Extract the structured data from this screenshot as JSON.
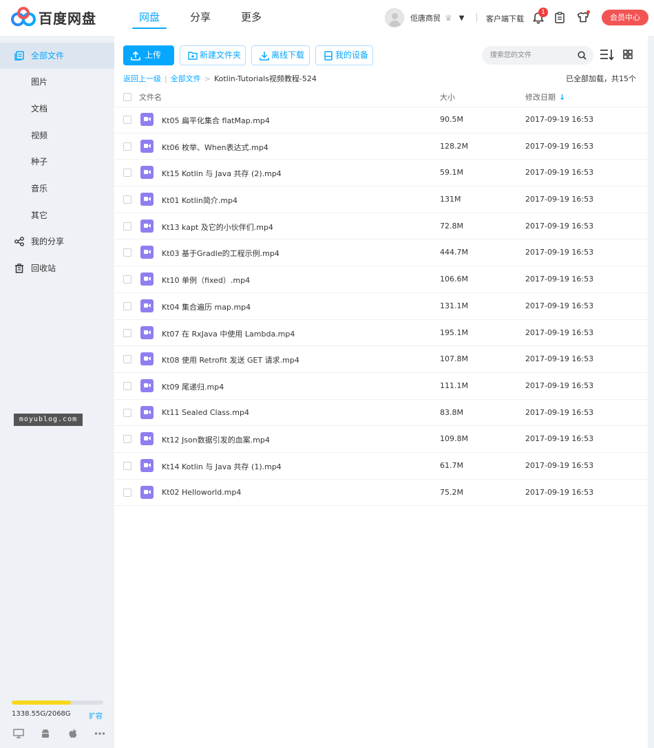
{
  "app": {
    "logo_text": "百度网盘",
    "nav": [
      "网盘",
      "分享",
      "更多"
    ],
    "username": "佢唐商贸",
    "client_download": "客户端下载",
    "notification_count": "1",
    "vip_label": "会员中心"
  },
  "colors": {
    "accent": "#06a7ff",
    "vip": "#f25454",
    "quota": "#f8d71c",
    "video_icon": "#8d7ff0"
  },
  "sidebar": {
    "items": [
      {
        "label": "全部文件",
        "icon": "files-icon",
        "active": true
      },
      {
        "label": "图片"
      },
      {
        "label": "文档"
      },
      {
        "label": "视频"
      },
      {
        "label": "种子"
      },
      {
        "label": "音乐"
      },
      {
        "label": "其它"
      },
      {
        "label": "我的分享",
        "icon": "share-icon"
      },
      {
        "label": "回收站",
        "icon": "trash-icon"
      }
    ],
    "watermark": "moyublog.com",
    "quota_text": "1338.55G/2068G",
    "quota_used_fraction": 0.647,
    "expand_label": "扩容",
    "devices": [
      "desktop-icon",
      "android-icon",
      "apple-icon",
      "more-icon"
    ]
  },
  "toolbar": {
    "upload": "上传",
    "new_folder": "新建文件夹",
    "offline_download": "离线下载",
    "my_devices": "我的设备",
    "search_placeholder": "搜索您的文件"
  },
  "breadcrumb": {
    "back": "返回上一级",
    "sep1": "|",
    "root": "全部文件",
    "sep2": ">",
    "current": "Kotlin-Tutorials视频教程-524"
  },
  "status": "已全部加载，共15个",
  "columns": {
    "name": "文件名",
    "size": "大小",
    "date": "修改日期",
    "date_sort": "↓"
  },
  "files": [
    {
      "name": "Kt05 扁平化集合 flatMap.mp4",
      "size": "90.5M",
      "date": "2017-09-19 16:53"
    },
    {
      "name": "Kt06 枚举、When表达式.mp4",
      "size": "128.2M",
      "date": "2017-09-19 16:53"
    },
    {
      "name": "Kt15 Kotlin 与 Java 共存 (2).mp4",
      "size": "59.1M",
      "date": "2017-09-19 16:53"
    },
    {
      "name": "Kt01 Kotlin简介.mp4",
      "size": "131M",
      "date": "2017-09-19 16:53"
    },
    {
      "name": "Kt13 kapt 及它的小伙伴们.mp4",
      "size": "72.8M",
      "date": "2017-09-19 16:53"
    },
    {
      "name": "Kt03 基于Gradle的工程示例.mp4",
      "size": "444.7M",
      "date": "2017-09-19 16:53"
    },
    {
      "name": "Kt10 单例（fixed）.mp4",
      "size": "106.6M",
      "date": "2017-09-19 16:53"
    },
    {
      "name": "Kt04 集合遍历 map.mp4",
      "size": "131.1M",
      "date": "2017-09-19 16:53"
    },
    {
      "name": "Kt07 在 RxJava 中使用 Lambda.mp4",
      "size": "195.1M",
      "date": "2017-09-19 16:53"
    },
    {
      "name": "Kt08 使用 Retrofit 发送 GET 请求.mp4",
      "size": "107.8M",
      "date": "2017-09-19 16:53"
    },
    {
      "name": "Kt09 尾递归.mp4",
      "size": "111.1M",
      "date": "2017-09-19 16:53"
    },
    {
      "name": "Kt11 Sealed Class.mp4",
      "size": "83.8M",
      "date": "2017-09-19 16:53"
    },
    {
      "name": "Kt12 Json数据引发的血案.mp4",
      "size": "109.8M",
      "date": "2017-09-19 16:53"
    },
    {
      "name": "Kt14 Kotlin 与 Java 共存 (1).mp4",
      "size": "61.7M",
      "date": "2017-09-19 16:53"
    },
    {
      "name": "Kt02 Helloworld.mp4",
      "size": "75.2M",
      "date": "2017-09-19 16:53"
    }
  ]
}
